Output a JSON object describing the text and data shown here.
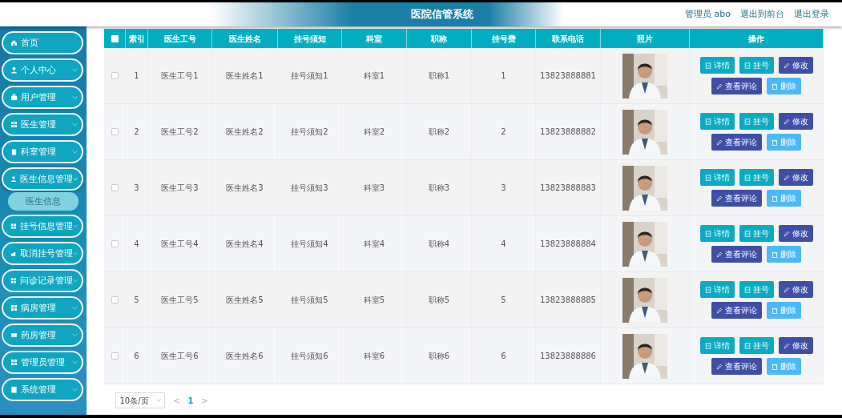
{
  "header": {
    "title": "医院信管系统",
    "links": [
      {
        "label": "管理员 abo"
      },
      {
        "label": "退出到前台"
      },
      {
        "label": "退出登录"
      }
    ]
  },
  "sidebar": {
    "items": [
      {
        "label": "首页",
        "kind": "link",
        "expanded": false
      },
      {
        "label": "个人中心",
        "kind": "menu",
        "expanded": false
      },
      {
        "label": "用户管理",
        "kind": "menu",
        "expanded": false
      },
      {
        "label": "医生管理",
        "kind": "menu",
        "expanded": false
      },
      {
        "label": "科室管理",
        "kind": "menu",
        "expanded": false
      },
      {
        "label": "医生信息管理",
        "kind": "menu",
        "expanded": true,
        "children": [
          {
            "label": "医生信息",
            "selected": false
          }
        ]
      },
      {
        "label": "挂号信息管理",
        "kind": "menu",
        "expanded": false
      },
      {
        "label": "取消挂号管理",
        "kind": "menu",
        "expanded": false
      },
      {
        "label": "问诊记录管理",
        "kind": "menu",
        "expanded": false
      },
      {
        "label": "病房管理",
        "kind": "menu",
        "expanded": false
      },
      {
        "label": "药房管理",
        "kind": "menu",
        "expanded": false
      },
      {
        "label": "管理员管理",
        "kind": "menu",
        "expanded": false
      },
      {
        "label": "系统管理",
        "kind": "menu",
        "expanded": false
      }
    ]
  },
  "table": {
    "header_checked": false,
    "columns": [
      "索引",
      "医生工号",
      "医生姓名",
      "挂号须知",
      "科室",
      "职称",
      "挂号费",
      "联系电话",
      "照片",
      "操作"
    ],
    "rows": [
      {
        "checked": false,
        "cells": [
          "1",
          "医生工号1",
          "医生姓名1",
          "挂号须知1",
          "科室1",
          "职称1",
          "1",
          "13823888881"
        ],
        "photo": {
          "kind": "picture"
        },
        "actions": [
          {
            "label": "详情",
            "kind": "info"
          },
          {
            "label": "挂号",
            "kind": "info"
          },
          {
            "label": "修改",
            "kind": "edit"
          },
          {
            "label": "查看评论",
            "kind": "edit"
          },
          {
            "label": "删除",
            "kind": "delete"
          }
        ]
      },
      {
        "checked": false,
        "cells": [
          "2",
          "医生工号2",
          "医生姓名2",
          "挂号须知2",
          "科室2",
          "职称2",
          "2",
          "13823888882"
        ],
        "photo": {
          "kind": "picture"
        },
        "actions": [
          {
            "label": "详情",
            "kind": "info"
          },
          {
            "label": "挂号",
            "kind": "info"
          },
          {
            "label": "修改",
            "kind": "edit"
          },
          {
            "label": "查看评论",
            "kind": "edit"
          },
          {
            "label": "删除",
            "kind": "delete"
          }
        ]
      },
      {
        "checked": false,
        "cells": [
          "3",
          "医生工号3",
          "医生姓名3",
          "挂号须知3",
          "科室3",
          "职称3",
          "3",
          "13823888883"
        ],
        "photo": {
          "kind": "picture"
        },
        "actions": [
          {
            "label": "详情",
            "kind": "info"
          },
          {
            "label": "挂号",
            "kind": "info"
          },
          {
            "label": "修改",
            "kind": "edit"
          },
          {
            "label": "查看评论",
            "kind": "edit"
          },
          {
            "label": "删除",
            "kind": "delete"
          }
        ]
      },
      {
        "checked": false,
        "cells": [
          "4",
          "医生工号4",
          "医生姓名4",
          "挂号须知4",
          "科室4",
          "职称4",
          "4",
          "13823888884"
        ],
        "photo": {
          "kind": "picture"
        },
        "actions": [
          {
            "label": "详情",
            "kind": "info"
          },
          {
            "label": "挂号",
            "kind": "info"
          },
          {
            "label": "修改",
            "kind": "edit"
          },
          {
            "label": "查看评论",
            "kind": "edit"
          },
          {
            "label": "删除",
            "kind": "delete"
          }
        ]
      },
      {
        "checked": false,
        "cells": [
          "5",
          "医生工号5",
          "医生姓名5",
          "挂号须知5",
          "科室5",
          "职称5",
          "5",
          "13823888885"
        ],
        "photo": {
          "kind": "picture"
        },
        "actions": [
          {
            "label": "详情",
            "kind": "info"
          },
          {
            "label": "挂号",
            "kind": "info"
          },
          {
            "label": "修改",
            "kind": "edit"
          },
          {
            "label": "查看评论",
            "kind": "edit"
          },
          {
            "label": "删除",
            "kind": "delete"
          }
        ]
      },
      {
        "checked": false,
        "cells": [
          "6",
          "医生工号6",
          "医生姓名6",
          "挂号须知6",
          "科室6",
          "职称6",
          "6",
          "13823888886"
        ],
        "photo": {
          "kind": "picture"
        },
        "actions": [
          {
            "label": "详情",
            "kind": "info"
          },
          {
            "label": "挂号",
            "kind": "info"
          },
          {
            "label": "修改",
            "kind": "edit"
          },
          {
            "label": "查看评论",
            "kind": "edit"
          },
          {
            "label": "删除",
            "kind": "delete"
          }
        ]
      }
    ]
  },
  "pagination": {
    "page_size": "10条/页",
    "prev": "<",
    "pages": [
      {
        "label": "1",
        "selected": true
      }
    ],
    "next": ">"
  }
}
